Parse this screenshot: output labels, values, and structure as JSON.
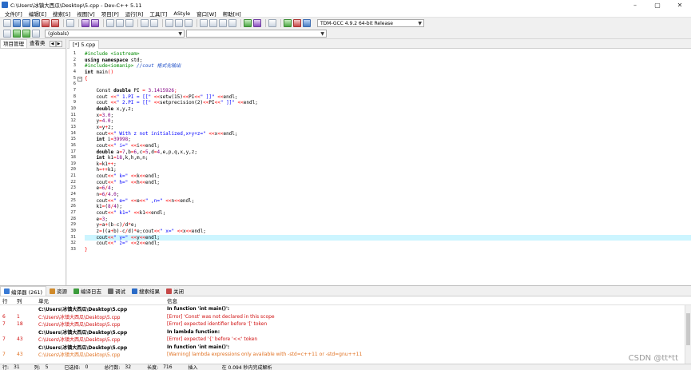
{
  "window": {
    "title": "C:\\Users\\冰镇大西瓜\\Desktop\\5.cpp - Dev-C++ 5.11",
    "minimize": "–",
    "maximize": "▢",
    "close": "✕"
  },
  "menu": [
    "文件[F]",
    "编辑[E]",
    "搜索[S]",
    "视图[V]",
    "项目[P]",
    "运行[R]",
    "工具[T]",
    "AStyle",
    "窗口[W]",
    "帮助[H]"
  ],
  "toolbar": {
    "compiler": "TDM-GCC 4.9.2 64-bit Release",
    "scope_combo": "(globals)",
    "member_combo": ""
  },
  "left_panel": {
    "tabs": [
      "项目管理",
      "查看类"
    ],
    "scroll_left": "◀",
    "scroll_right": "▶"
  },
  "editor": {
    "tab_label": "[*] 5.cpp",
    "current_line": 31,
    "lines": [
      [
        {
          "t": "dir",
          "v": "#include <iostream>"
        }
      ],
      [
        {
          "t": "kw",
          "v": "using namespace"
        },
        {
          "t": "plain",
          "v": " std;"
        }
      ],
      [
        {
          "t": "dir",
          "v": "#include<iomanip> "
        },
        {
          "t": "cm",
          "v": "//cout 格式化输出"
        }
      ],
      [
        {
          "t": "kw",
          "v": "int"
        },
        {
          "t": "plain",
          "v": " main"
        },
        {
          "t": "sym",
          "v": "()"
        }
      ],
      [
        {
          "t": "sym",
          "v": "{"
        }
      ],
      [
        {
          "t": "plain",
          "v": ""
        }
      ],
      [
        {
          "t": "plain",
          "v": "    Const "
        },
        {
          "t": "kw",
          "v": "double"
        },
        {
          "t": "plain",
          "v": " PI "
        },
        {
          "t": "sym",
          "v": "="
        },
        {
          "t": "num",
          "v": " 3.1415926"
        },
        {
          "t": "sym",
          "v": ";"
        }
      ],
      [
        {
          "t": "plain",
          "v": "    cout "
        },
        {
          "t": "sym",
          "v": "<<"
        },
        {
          "t": "str",
          "v": "\" 1.PI = [[\" "
        },
        {
          "t": "sym",
          "v": "<<"
        },
        {
          "t": "plain",
          "v": "setw(15)"
        },
        {
          "t": "sym",
          "v": "<<"
        },
        {
          "t": "plain",
          "v": "PI"
        },
        {
          "t": "sym",
          "v": "<<"
        },
        {
          "t": "str",
          "v": "\" ]]\" "
        },
        {
          "t": "sym",
          "v": "<<"
        },
        {
          "t": "plain",
          "v": "endl;"
        }
      ],
      [
        {
          "t": "plain",
          "v": "    cout "
        },
        {
          "t": "sym",
          "v": "<<"
        },
        {
          "t": "str",
          "v": "\" 2.PI = [[\" "
        },
        {
          "t": "sym",
          "v": "<<"
        },
        {
          "t": "plain",
          "v": "setprecision(2)"
        },
        {
          "t": "sym",
          "v": "<<"
        },
        {
          "t": "plain",
          "v": "PI"
        },
        {
          "t": "sym",
          "v": "<<"
        },
        {
          "t": "str",
          "v": "\" ]]\" "
        },
        {
          "t": "sym",
          "v": "<<"
        },
        {
          "t": "plain",
          "v": "endl;"
        }
      ],
      [
        {
          "t": "kw",
          "v": "    double"
        },
        {
          "t": "plain",
          "v": " x,y,z;"
        }
      ],
      [
        {
          "t": "plain",
          "v": "    x"
        },
        {
          "t": "sym",
          "v": "="
        },
        {
          "t": "num",
          "v": "3.0"
        },
        {
          "t": "plain",
          "v": ";"
        }
      ],
      [
        {
          "t": "plain",
          "v": "    y"
        },
        {
          "t": "sym",
          "v": "="
        },
        {
          "t": "num",
          "v": "4.0"
        },
        {
          "t": "plain",
          "v": ";"
        }
      ],
      [
        {
          "t": "plain",
          "v": "    x"
        },
        {
          "t": "sym",
          "v": "="
        },
        {
          "t": "plain",
          "v": "y"
        },
        {
          "t": "sym",
          "v": "+"
        },
        {
          "t": "plain",
          "v": "z;"
        }
      ],
      [
        {
          "t": "plain",
          "v": "    cout"
        },
        {
          "t": "sym",
          "v": "<<"
        },
        {
          "t": "str",
          "v": "\" With z not initialized,x+y+z=\" "
        },
        {
          "t": "sym",
          "v": "<<"
        },
        {
          "t": "plain",
          "v": "x"
        },
        {
          "t": "sym",
          "v": "<<"
        },
        {
          "t": "plain",
          "v": "endl;"
        }
      ],
      [
        {
          "t": "kw",
          "v": "    int"
        },
        {
          "t": "plain",
          "v": " i"
        },
        {
          "t": "sym",
          "v": "="
        },
        {
          "t": "num",
          "v": "39998"
        },
        {
          "t": "plain",
          "v": ";"
        }
      ],
      [
        {
          "t": "plain",
          "v": "    cout"
        },
        {
          "t": "sym",
          "v": "<<"
        },
        {
          "t": "str",
          "v": "\" i=\" "
        },
        {
          "t": "sym",
          "v": "<<"
        },
        {
          "t": "plain",
          "v": "i"
        },
        {
          "t": "sym",
          "v": "<<"
        },
        {
          "t": "plain",
          "v": "endl;"
        }
      ],
      [
        {
          "t": "kw",
          "v": "    double"
        },
        {
          "t": "plain",
          "v": " a"
        },
        {
          "t": "sym",
          "v": "="
        },
        {
          "t": "num",
          "v": "7"
        },
        {
          "t": "plain",
          "v": ",b"
        },
        {
          "t": "sym",
          "v": "="
        },
        {
          "t": "num",
          "v": "6"
        },
        {
          "t": "plain",
          "v": ",c"
        },
        {
          "t": "sym",
          "v": "="
        },
        {
          "t": "num",
          "v": "5"
        },
        {
          "t": "plain",
          "v": ",d"
        },
        {
          "t": "sym",
          "v": "="
        },
        {
          "t": "num",
          "v": "4"
        },
        {
          "t": "plain",
          "v": ",e,p,q,x,y,z;"
        }
      ],
      [
        {
          "t": "kw",
          "v": "    int"
        },
        {
          "t": "plain",
          "v": " k1"
        },
        {
          "t": "sym",
          "v": "="
        },
        {
          "t": "num",
          "v": "18"
        },
        {
          "t": "plain",
          "v": ",k,h,m,n;"
        }
      ],
      [
        {
          "t": "plain",
          "v": "    k"
        },
        {
          "t": "sym",
          "v": "="
        },
        {
          "t": "plain",
          "v": "k1"
        },
        {
          "t": "sym",
          "v": "++"
        },
        {
          "t": "plain",
          "v": ";"
        }
      ],
      [
        {
          "t": "plain",
          "v": "    h"
        },
        {
          "t": "sym",
          "v": "=++"
        },
        {
          "t": "plain",
          "v": "k1;"
        }
      ],
      [
        {
          "t": "plain",
          "v": "    cout"
        },
        {
          "t": "sym",
          "v": "<<"
        },
        {
          "t": "str",
          "v": "\" k=\" "
        },
        {
          "t": "sym",
          "v": "<<"
        },
        {
          "t": "plain",
          "v": "k"
        },
        {
          "t": "sym",
          "v": "<<"
        },
        {
          "t": "plain",
          "v": "endl;"
        }
      ],
      [
        {
          "t": "plain",
          "v": "    cout"
        },
        {
          "t": "sym",
          "v": "<<"
        },
        {
          "t": "str",
          "v": "\" h=\" "
        },
        {
          "t": "sym",
          "v": "<<"
        },
        {
          "t": "plain",
          "v": "h"
        },
        {
          "t": "sym",
          "v": "<<"
        },
        {
          "t": "plain",
          "v": "endl;"
        }
      ],
      [
        {
          "t": "plain",
          "v": "    e"
        },
        {
          "t": "sym",
          "v": "="
        },
        {
          "t": "num",
          "v": "6"
        },
        {
          "t": "sym",
          "v": "/"
        },
        {
          "t": "num",
          "v": "4"
        },
        {
          "t": "plain",
          "v": ";"
        }
      ],
      [
        {
          "t": "plain",
          "v": "    n"
        },
        {
          "t": "sym",
          "v": "="
        },
        {
          "t": "num",
          "v": "6"
        },
        {
          "t": "sym",
          "v": "/"
        },
        {
          "t": "num",
          "v": "4.0"
        },
        {
          "t": "plain",
          "v": ";"
        }
      ],
      [
        {
          "t": "plain",
          "v": "    cout"
        },
        {
          "t": "sym",
          "v": "<<"
        },
        {
          "t": "str",
          "v": "\" e=\" "
        },
        {
          "t": "sym",
          "v": "<<"
        },
        {
          "t": "plain",
          "v": "e"
        },
        {
          "t": "sym",
          "v": "<<"
        },
        {
          "t": "str",
          "v": "\" ,n=\" "
        },
        {
          "t": "sym",
          "v": "<<"
        },
        {
          "t": "plain",
          "v": "n"
        },
        {
          "t": "sym",
          "v": "<<"
        },
        {
          "t": "plain",
          "v": "endl;"
        }
      ],
      [
        {
          "t": "plain",
          "v": "    k1"
        },
        {
          "t": "sym",
          "v": "="
        },
        {
          "t": "plain",
          "v": "("
        },
        {
          "t": "num",
          "v": "8"
        },
        {
          "t": "sym",
          "v": "/"
        },
        {
          "t": "num",
          "v": "4"
        },
        {
          "t": "plain",
          "v": ");"
        }
      ],
      [
        {
          "t": "plain",
          "v": "    cout"
        },
        {
          "t": "sym",
          "v": "<<"
        },
        {
          "t": "str",
          "v": "\" k1=\" "
        },
        {
          "t": "sym",
          "v": "<<"
        },
        {
          "t": "plain",
          "v": "k1"
        },
        {
          "t": "sym",
          "v": "<<"
        },
        {
          "t": "plain",
          "v": "endl;"
        }
      ],
      [
        {
          "t": "plain",
          "v": "    e"
        },
        {
          "t": "sym",
          "v": "="
        },
        {
          "t": "num",
          "v": "3"
        },
        {
          "t": "plain",
          "v": ";"
        }
      ],
      [
        {
          "t": "plain",
          "v": "    y"
        },
        {
          "t": "sym",
          "v": "="
        },
        {
          "t": "plain",
          "v": "a"
        },
        {
          "t": "sym",
          "v": "+"
        },
        {
          "t": "plain",
          "v": "(b"
        },
        {
          "t": "sym",
          "v": "-"
        },
        {
          "t": "plain",
          "v": "c)"
        },
        {
          "t": "sym",
          "v": "/"
        },
        {
          "t": "plain",
          "v": "d"
        },
        {
          "t": "sym",
          "v": "*"
        },
        {
          "t": "plain",
          "v": "e;"
        }
      ],
      [
        {
          "t": "plain",
          "v": "    z"
        },
        {
          "t": "sym",
          "v": "="
        },
        {
          "t": "plain",
          "v": "((a"
        },
        {
          "t": "sym",
          "v": "+"
        },
        {
          "t": "plain",
          "v": "b)"
        },
        {
          "t": "sym",
          "v": "-"
        },
        {
          "t": "plain",
          "v": "c"
        },
        {
          "t": "sym",
          "v": "/"
        },
        {
          "t": "plain",
          "v": "d)"
        },
        {
          "t": "sym",
          "v": "*"
        },
        {
          "t": "plain",
          "v": "e;cout"
        },
        {
          "t": "sym",
          "v": "<<"
        },
        {
          "t": "str",
          "v": "\" x=\" "
        },
        {
          "t": "sym",
          "v": "<<"
        },
        {
          "t": "plain",
          "v": "x"
        },
        {
          "t": "sym",
          "v": "<<"
        },
        {
          "t": "plain",
          "v": "endl;"
        }
      ],
      [
        {
          "t": "plain",
          "v": "    cout"
        },
        {
          "t": "sym",
          "v": "<<"
        },
        {
          "t": "str",
          "v": "\" y=\" "
        },
        {
          "t": "sym",
          "v": "<<"
        },
        {
          "t": "plain",
          "v": "y"
        },
        {
          "t": "sym",
          "v": "<<"
        },
        {
          "t": "plain",
          "v": "endl;"
        }
      ],
      [
        {
          "t": "plain",
          "v": "    cout"
        },
        {
          "t": "sym",
          "v": "<<"
        },
        {
          "t": "str",
          "v": "\" z=\" "
        },
        {
          "t": "sym",
          "v": "<<"
        },
        {
          "t": "plain",
          "v": "z"
        },
        {
          "t": "sym",
          "v": "<<"
        },
        {
          "t": "plain",
          "v": "endl;"
        }
      ],
      [
        {
          "t": "sym",
          "v": "}"
        }
      ]
    ]
  },
  "bottom_panel": {
    "tabs": [
      {
        "label": "编译器 (261)",
        "color": "#3a7bd5"
      },
      {
        "label": "资源",
        "color": "#d08a2a"
      },
      {
        "label": "编译日志",
        "color": "#3c9c3c"
      },
      {
        "label": "调试",
        "color": "#6a6a6a"
      },
      {
        "label": "搜索结果",
        "color": "#2a6bc7"
      },
      {
        "label": "关闭",
        "color": "#c64848"
      }
    ],
    "headers": {
      "row": "行",
      "col": "列",
      "unit": "单元",
      "msg": "信息"
    },
    "rows": [
      {
        "row": "",
        "col": "",
        "unit": "C:\\Users\\冰镇大西瓜\\Desktop\\5.cpp",
        "msg": "In function 'int main()':",
        "kind": "bold"
      },
      {
        "row": "6",
        "col": "1",
        "unit": "C:\\Users\\冰镇大西瓜\\Desktop\\5.cpp",
        "msg": "[Error] 'Const' was not declared in this scope",
        "kind": "err"
      },
      {
        "row": "7",
        "col": "18",
        "unit": "C:\\Users\\冰镇大西瓜\\Desktop\\5.cpp",
        "msg": "[Error] expected identifier before '[' token",
        "kind": "err"
      },
      {
        "row": "",
        "col": "",
        "unit": "C:\\Users\\冰镇大西瓜\\Desktop\\5.cpp",
        "msg": "In lambda function:",
        "kind": "bold"
      },
      {
        "row": "7",
        "col": "43",
        "unit": "C:\\Users\\冰镇大西瓜\\Desktop\\5.cpp",
        "msg": "[Error] expected '{' before '<<' token",
        "kind": "err"
      },
      {
        "row": "",
        "col": "",
        "unit": "C:\\Users\\冰镇大西瓜\\Desktop\\5.cpp",
        "msg": "In function 'int main()':",
        "kind": "bold"
      },
      {
        "row": "7",
        "col": "43",
        "unit": "C:\\Users\\冰镇大西瓜\\Desktop\\5.cpp",
        "msg": "[Warning] lambda expressions only available with -std=c++11 or -std=gnu++11",
        "kind": "warn"
      }
    ]
  },
  "status": {
    "row": "行:",
    "row_val": "31",
    "col": "列:",
    "col_val": "5",
    "sel": "已选择:",
    "sel_val": "0",
    "total": "总行数:",
    "total_val": "32",
    "len": "长度:",
    "len_val": "716",
    "mode": "插入",
    "parsed": "在 0.094 秒内完成解析"
  },
  "watermark": "CSDN @tt*tt"
}
